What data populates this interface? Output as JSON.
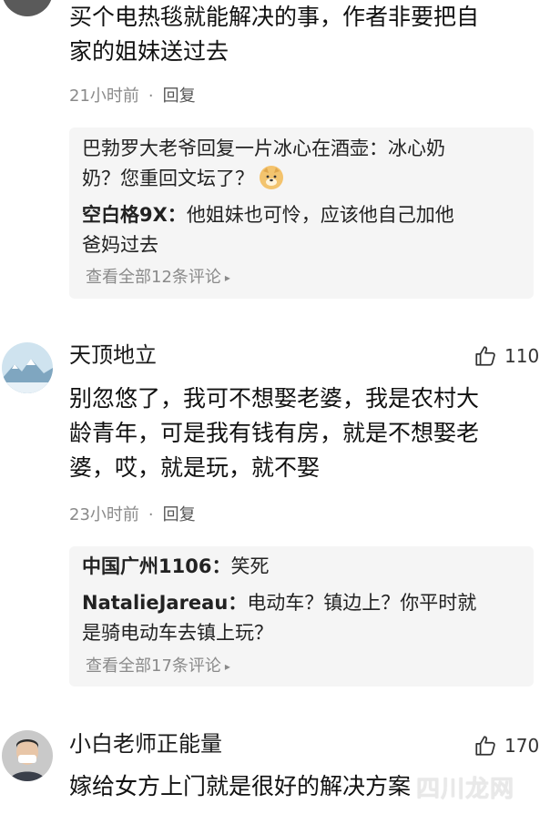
{
  "comments": [
    {
      "body_lines": [
        "买个电热毯就能解决的事，作者非要把自",
        "家的姐妹送过去"
      ],
      "time": "21小时前",
      "reply_label": "回复",
      "replies": [
        {
          "author": "巴勃罗大老爷回复一片冰心在酒壶：",
          "text": "冰心奶",
          "cont": "奶？您重回文坛了？"
        },
        {
          "author": "空白格9X：",
          "text": "他姐妹也可怜，应该他自己加他",
          "cont": "爸妈过去"
        }
      ],
      "view_all": "查看全部12条评论"
    },
    {
      "name": "天顶地立",
      "likes": "110",
      "body_lines": [
        "别忽悠了，我可不想娶老婆，我是农村大",
        "龄青年，可是我有钱有房，就是不想娶老",
        "婆，哎，就是玩，就不娶"
      ],
      "time": "23小时前",
      "reply_label": "回复",
      "replies": [
        {
          "author": "中国广州1106：",
          "text": "笑死"
        },
        {
          "author": "NatalieJareau：",
          "text": "电动车？镇边上？你平时就",
          "cont": "是骑电动车去镇上玩？"
        }
      ],
      "view_all": "查看全部17条评论"
    },
    {
      "name": "小白老师正能量",
      "likes": "170",
      "body_lines": [
        "嫁给女方上门就是很好的解决方案"
      ]
    }
  ],
  "watermark": "四川龙网",
  "colors": {
    "text": "#1a1a1a",
    "muted": "#8a8a8a",
    "reply_bg": "#f5f5f5"
  }
}
